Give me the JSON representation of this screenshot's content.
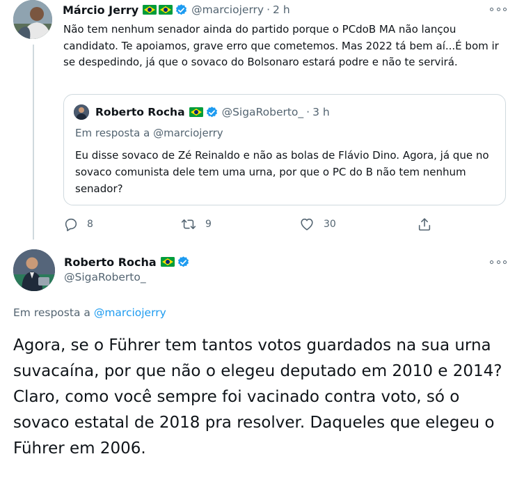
{
  "tweet1": {
    "author_name": "Márcio Jerry",
    "author_handle": "@marciojerry",
    "separator": "·",
    "time": "2 h",
    "text": "Não tem nenhum senador ainda do partido porque o PCdoB MA não lançou candidato. Te apoiamos, grave erro que cometemos. Mas 2022 tá bem aí...É bom ir se despedindo, já que o sovaco do Bolsonaro estará podre e não te servirá.",
    "icons": [
      "brazil-flag-icon",
      "brazil-flag-icon",
      "verified-badge-icon",
      "more-options-icon"
    ],
    "quoted": {
      "author_name": "Roberto Rocha",
      "author_handle": "@SigaRoberto_",
      "separator": "·",
      "time": "3 h",
      "reply_prefix": "Em resposta a",
      "reply_to": "@marciojerry",
      "text": "Eu disse sovaco de Zé Reinaldo e não as bolas de Flávio Dino. Agora, já que no sovaco comunista dele tem uma urna, por que o PC do B não tem nenhum senador?",
      "icons": [
        "brazil-flag-icon",
        "verified-badge-icon"
      ]
    },
    "actions": {
      "reply_count": "8",
      "retweet_count": "9",
      "like_count": "30",
      "icons": [
        "reply-icon",
        "retweet-icon",
        "like-icon",
        "share-icon"
      ]
    }
  },
  "tweet2": {
    "author_name": "Roberto Rocha",
    "author_handle": "@SigaRoberto_",
    "reply_prefix": "Em resposta a",
    "reply_to": "@marciojerry",
    "text_paragraphs": [
      "Agora, se o Führer tem tantos votos guardados na sua urna suvacaína, por que não o elegeu deputado em 2010 e 2014?",
      "Claro, como você sempre foi vacinado contra voto, só o sovaco estatal de 2018 pra resolver. Daqueles que elegeu o Führer em 2006."
    ],
    "icons": [
      "brazil-flag-icon",
      "verified-badge-icon",
      "more-options-icon"
    ]
  },
  "colors": {
    "text_primary": "#0f1419",
    "text_secondary": "#536471",
    "accent": "#1d9bf0",
    "border": "#cfd9de",
    "flag_green": "#009c3b",
    "flag_yellow": "#ffdf00",
    "flag_blue": "#002776"
  }
}
